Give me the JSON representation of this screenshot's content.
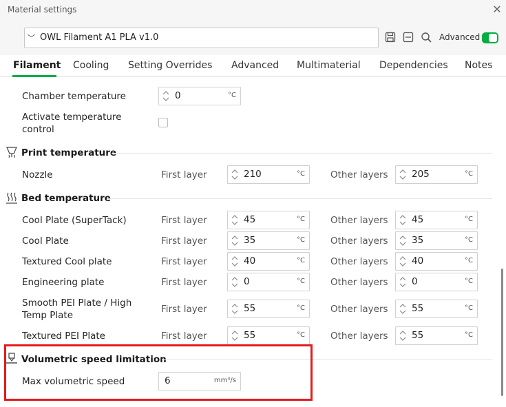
{
  "window": {
    "title": "Material settings"
  },
  "preset": {
    "value": "OWL Filament A1 PLA v1.0"
  },
  "toolbar": {
    "advanced_label": "Advanced"
  },
  "tabs": [
    "Filament",
    "Cooling",
    "Setting Overrides",
    "Advanced",
    "Multimaterial",
    "Dependencies",
    "Notes"
  ],
  "units": {
    "celsius": "°C",
    "volumetric": "mm³/s"
  },
  "labels": {
    "first_layer": "First layer",
    "other_layers": "Other layers"
  },
  "chamber": {
    "label": "Chamber temperature",
    "value": "0"
  },
  "activate_temp": {
    "label_line1": "Activate temperature",
    "label_line2": "control"
  },
  "print_temperature": {
    "title": "Print temperature",
    "nozzle": {
      "label": "Nozzle",
      "first": "210",
      "other": "205"
    }
  },
  "bed_temperature": {
    "title": "Bed temperature",
    "rows": [
      {
        "label": "Cool Plate (SuperTack)",
        "first": "45",
        "other": "45"
      },
      {
        "label": "Cool Plate",
        "first": "35",
        "other": "35"
      },
      {
        "label": "Textured Cool plate",
        "first": "40",
        "other": "40"
      },
      {
        "label": "Engineering plate",
        "first": "0",
        "other": "0"
      },
      {
        "label_line1": "Smooth PEI Plate / High",
        "label_line2": "Temp Plate",
        "first": "55",
        "other": "55"
      },
      {
        "label": "Textured PEI Plate",
        "first": "55",
        "other": "55"
      }
    ]
  },
  "volumetric": {
    "title": "Volumetric speed limitation",
    "label": "Max volumetric speed",
    "value": "6"
  }
}
